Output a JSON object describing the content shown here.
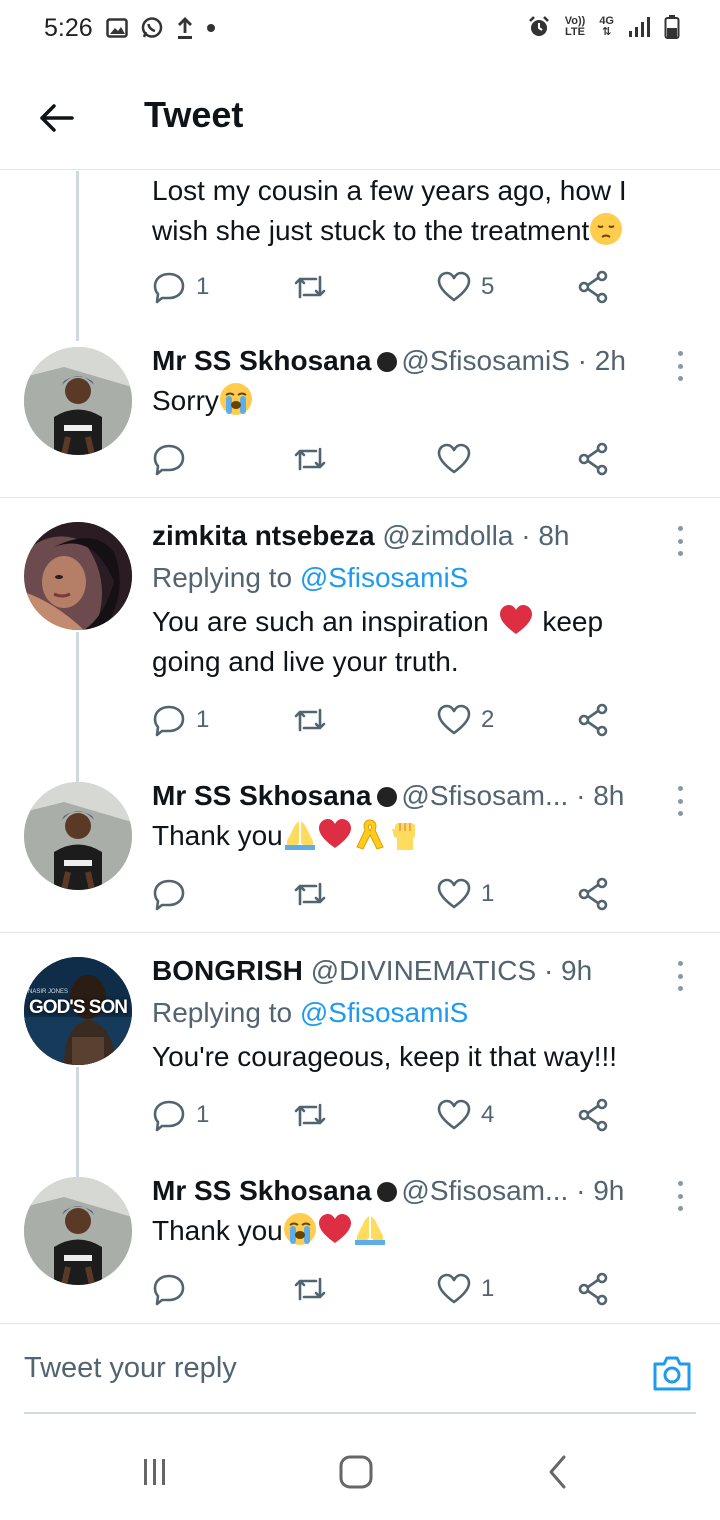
{
  "status_bar": {
    "time": "5:26",
    "network": "4G",
    "lte_top": "Vo))",
    "lte_bottom": "LTE"
  },
  "header": {
    "title": "Tweet"
  },
  "tweets": [
    {
      "text": "Lost my cousin a few years ago, how I wish she just stuck to the treatment",
      "text_line1": "Lost my cousin a few years ago, how I",
      "text_line2": "wish she just stuck to the treatment",
      "replies": "1",
      "retweets": "",
      "likes": "5"
    },
    {
      "name": "Mr SS Skhosana",
      "handle": "@SfisosamiS",
      "time": "· 2h",
      "text": "Sorry",
      "replies": "",
      "retweets": "",
      "likes": ""
    },
    {
      "name": "zimkita ntsebeza",
      "handle": "@zimdolla",
      "time": "· 8h",
      "replying_label": "Replying to",
      "replying_handle": "@SfisosamiS",
      "text_line1": "You are such an inspiration",
      "text_line1_end": "keep",
      "text_line2": "going and live your truth.",
      "replies": "1",
      "retweets": "",
      "likes": "2"
    },
    {
      "name": "Mr SS Skhosana",
      "handle": "@Sfisosam...",
      "time": "· 8h",
      "text": "Thank you",
      "replies": "",
      "retweets": "",
      "likes": "1"
    },
    {
      "name": "BONGRISH",
      "handle": "@DIVINEMATICS",
      "time": "· 9h",
      "replying_label": "Replying to",
      "replying_handle": "@SfisosamiS",
      "text": "You're courageous, keep it that way!!!",
      "avatar_label": "GOD'S SON",
      "avatar_small": "NASIR JONES",
      "replies": "1",
      "retweets": "",
      "likes": "4"
    },
    {
      "name": "Mr SS Skhosana",
      "handle": "@Sfisosam...",
      "time": "· 9h",
      "text": "Thank you",
      "replies": "",
      "retweets": "",
      "likes": "1"
    }
  ],
  "reply_box": {
    "placeholder": "Tweet your reply"
  },
  "colors": {
    "accent": "#1d9bf0",
    "text": "#0f1419",
    "secondary": "#536471",
    "divider": "#e6e6e6",
    "heart": "#e0245e"
  }
}
